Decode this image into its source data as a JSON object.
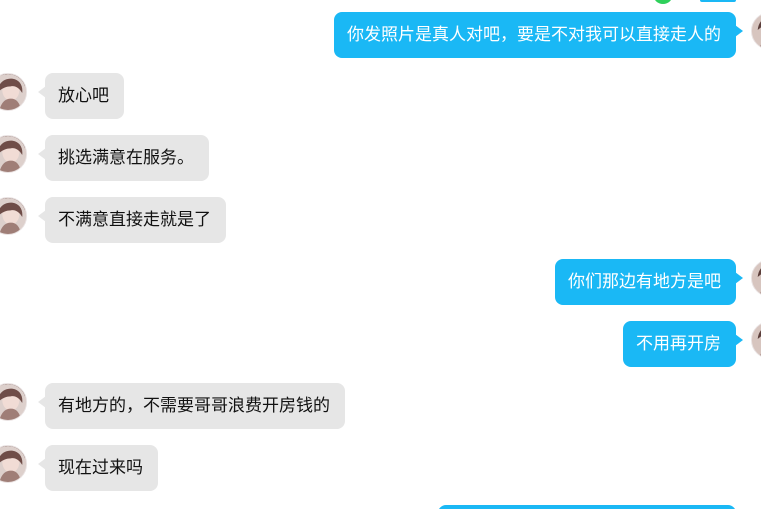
{
  "messages": [
    {
      "text": "你发照片是真人对吧，要是不对我可以直接走人的"
    },
    {
      "text": "放心吧"
    },
    {
      "text": "挑选满意在服务。"
    },
    {
      "text": "不满意直接走就是了"
    },
    {
      "text": "你们那边有地方是吧"
    },
    {
      "text": "不用再开房"
    },
    {
      "text": "有地方的，不需要哥哥浪费开房钱的"
    },
    {
      "text": "现在过来吗"
    }
  ]
}
